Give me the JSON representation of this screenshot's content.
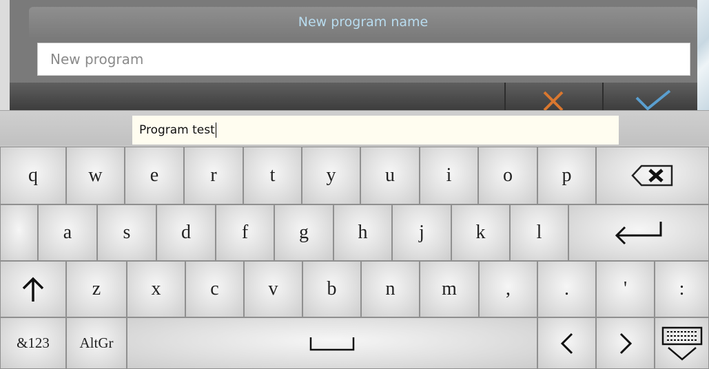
{
  "dialog": {
    "title": "New program name",
    "name_placeholder": "New program",
    "cancel_icon": "close-icon",
    "confirm_icon": "check-icon"
  },
  "keyboard": {
    "input_value": "Program test",
    "row1": [
      "q",
      "w",
      "e",
      "r",
      "t",
      "y",
      "u",
      "i",
      "o",
      "p"
    ],
    "row2": [
      "a",
      "s",
      "d",
      "f",
      "g",
      "h",
      "j",
      "k",
      "l"
    ],
    "row3": [
      "z",
      "x",
      "c",
      "v",
      "b",
      "n",
      "m",
      ",",
      ".",
      "'",
      ":"
    ],
    "mode_key": "&123",
    "altgr_key": "AltGr",
    "icons": {
      "backspace": "backspace-icon",
      "enter": "enter-icon",
      "shift": "shift-icon",
      "space": "space-icon",
      "left": "chevron-left-icon",
      "right": "chevron-right-icon",
      "hide": "hide-keyboard-icon"
    },
    "colors": {
      "title_text": "#b8dcef",
      "cancel": "#d9772f",
      "confirm": "#5a9fd0"
    }
  }
}
